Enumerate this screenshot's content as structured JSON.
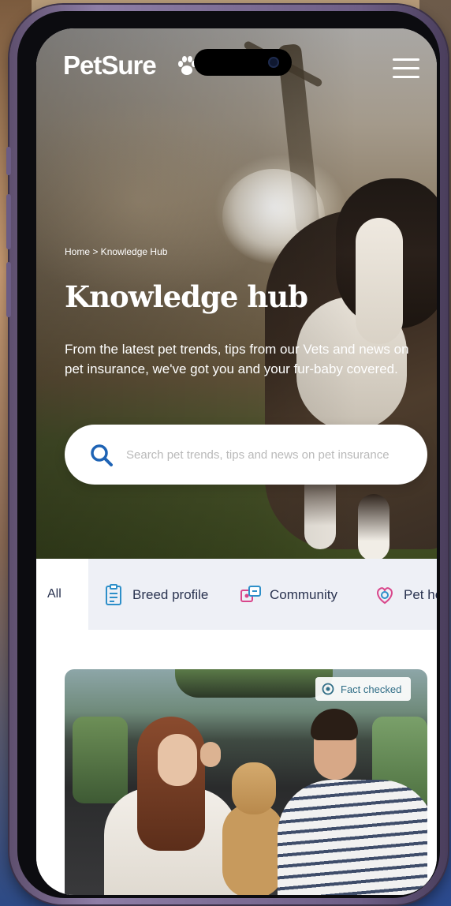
{
  "app": {
    "brand": "PetSure",
    "menu_icon": "hamburger-icon"
  },
  "hero": {
    "breadcrumb": "Home > Knowledge Hub",
    "title": "Knowledge hub",
    "intro": "From the latest pet trends, tips from our Vets and news on pet insurance, we've got you and your fur-baby covered."
  },
  "search": {
    "icon": "search-icon",
    "placeholder": "Search pet trends, tips and news on pet insurance",
    "value": ""
  },
  "tabs": [
    {
      "label": "All",
      "icon": "",
      "active": true
    },
    {
      "label": "Breed profile",
      "icon": "clipboard-icon"
    },
    {
      "label": "Community",
      "icon": "community-icon"
    },
    {
      "label": "Pet he",
      "icon": "pet-health-icon"
    }
  ],
  "article": {
    "badge": "Fact checked",
    "badge_icon": "check-circle-icon"
  },
  "colors": {
    "accent": "#1e63b5",
    "text_dark": "#2a3350",
    "tab_bg": "#eef0f6",
    "badge_text": "#2f6d86"
  }
}
